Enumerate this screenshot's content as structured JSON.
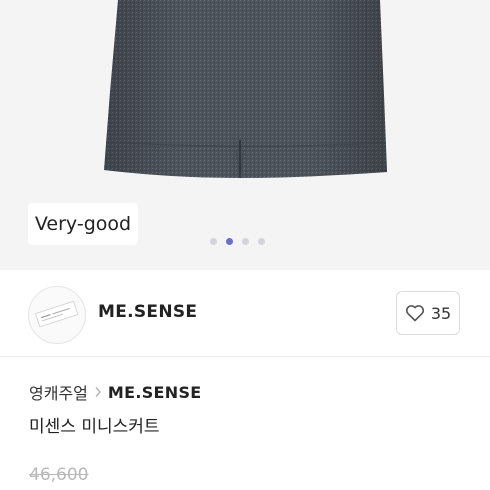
{
  "product": {
    "condition_badge": "Very-good",
    "image_count": 4,
    "active_image_index": 1,
    "title": "미센스 미니스커트",
    "original_price": "46,600"
  },
  "shop": {
    "name": "ME.SENSE",
    "like_count": "35",
    "like_icon": "heart-outline-icon"
  },
  "breadcrumb": {
    "category": "영캐주얼",
    "separator_icon": "chevron-right-icon",
    "brand": "ME.SENSE"
  },
  "colors": {
    "image_background": "#f4f4f4",
    "skirt_fabric": "#4b5058",
    "active_dot": "#6b6fc8",
    "inactive_dot": "#d3d3db",
    "price_strike": "#b8b8b8"
  }
}
